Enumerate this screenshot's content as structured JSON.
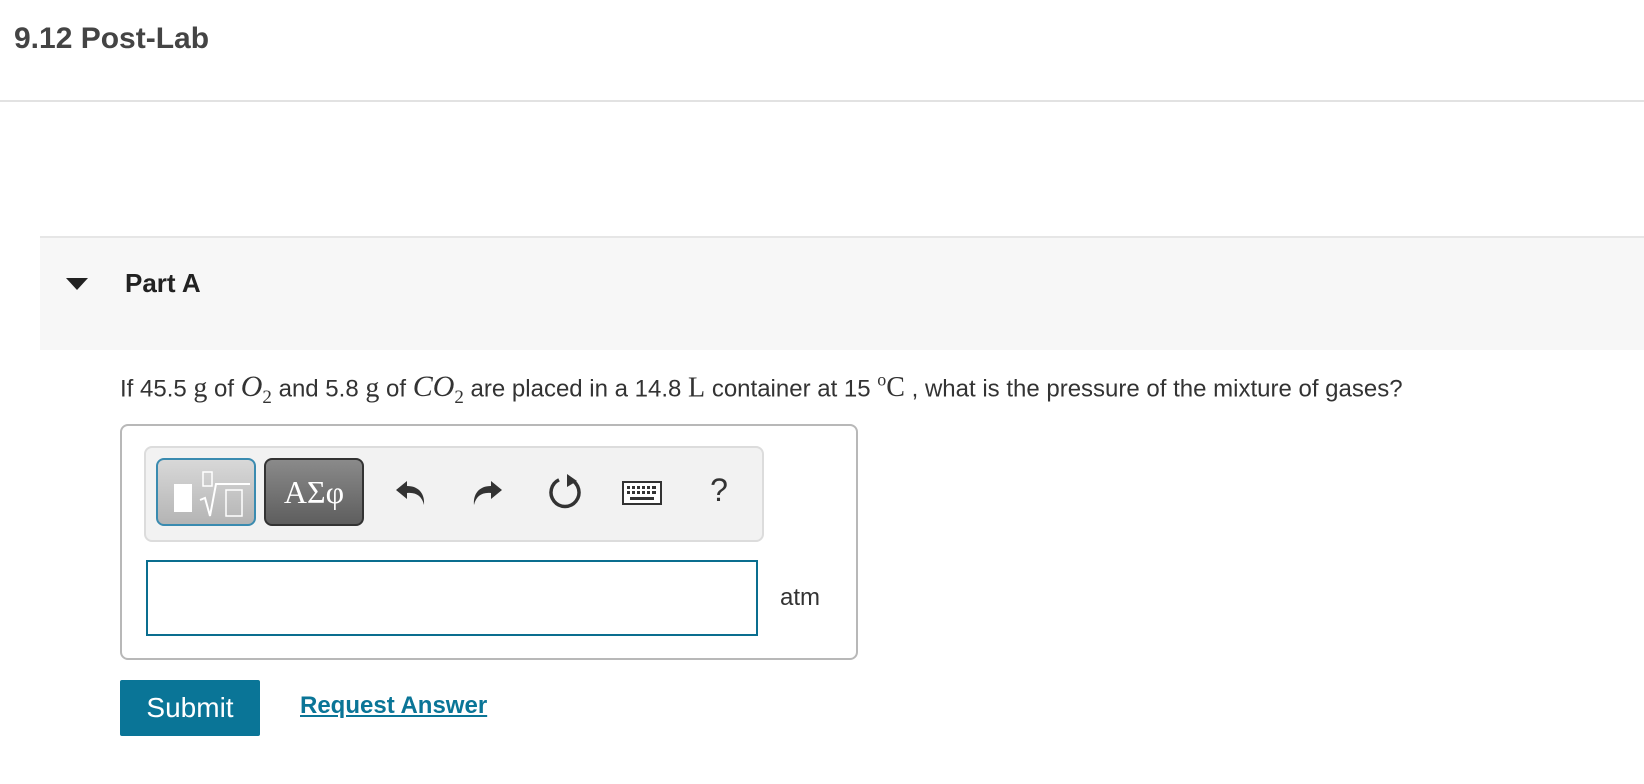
{
  "page": {
    "title": "9.12 Post-Lab"
  },
  "part": {
    "label": "Part A"
  },
  "question": {
    "t1": "If 45.5 ",
    "u1": "g",
    "t2": " of ",
    "s1_base": "O",
    "s1_sub": "2",
    "t3": " and 5.8 ",
    "u2": "g",
    "t4": " of ",
    "s2_base": "CO",
    "s2_sub": "2",
    "t5": " are placed in a 14.8 ",
    "u3": "L",
    "t6": " container at 15 ",
    "deg_sup": "o",
    "deg_unit": "C",
    "t7": " , what is the pressure of the mixture of gases?"
  },
  "toolbar": {
    "greek_label": "ΑΣφ",
    "help_label": "?",
    "icons": [
      "templates-icon",
      "greek-symbols-icon",
      "undo-icon",
      "redo-icon",
      "reset-icon",
      "keyboard-icon",
      "help-icon"
    ]
  },
  "answer": {
    "value": "",
    "placeholder": "",
    "unit": "atm"
  },
  "actions": {
    "submit_label": "Submit",
    "request_answer_label": "Request Answer"
  },
  "colors": {
    "accent": "#0a7597",
    "input_border": "#0a6e8f",
    "part_header_bg": "#f7f7f7"
  }
}
